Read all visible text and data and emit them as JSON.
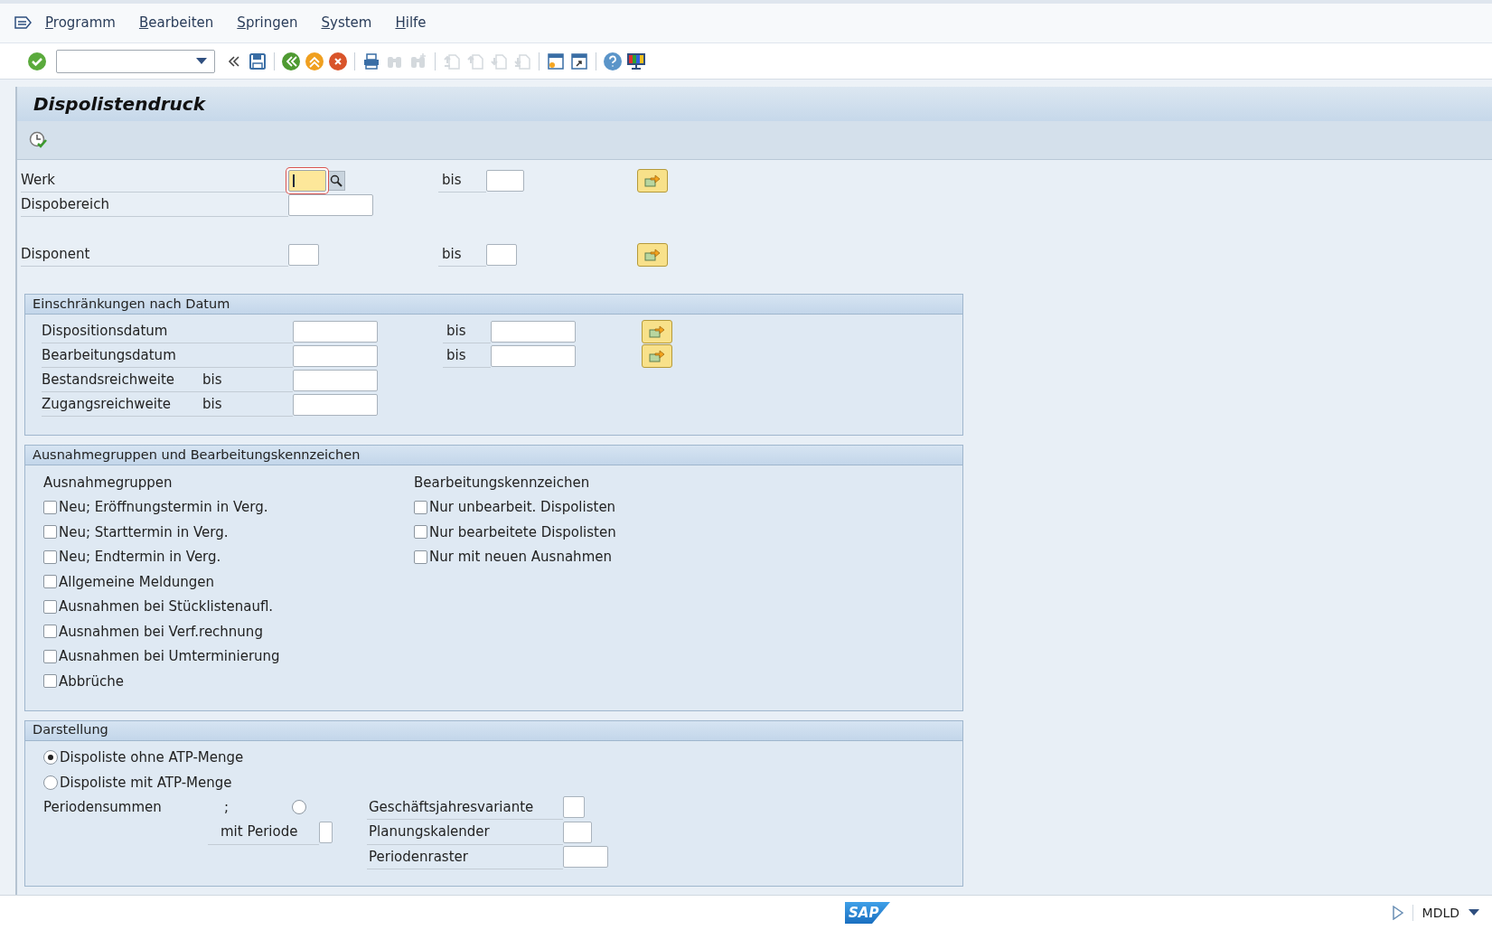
{
  "menu_bar": {
    "items": [
      "Programm",
      "Bearbeiten",
      "Springen",
      "System",
      "Hilfe"
    ]
  },
  "toolbar": [
    {
      "kind": "enter",
      "disabled": false
    },
    {
      "kind": "command"
    },
    {
      "kind": "collapse",
      "disabled": false
    },
    {
      "kind": "save",
      "disabled": false
    },
    {
      "kind": "sep"
    },
    {
      "kind": "back",
      "disabled": false
    },
    {
      "kind": "exit",
      "disabled": false
    },
    {
      "kind": "cancel",
      "disabled": false
    },
    {
      "kind": "sep"
    },
    {
      "kind": "print",
      "disabled": false
    },
    {
      "kind": "find",
      "disabled": true
    },
    {
      "kind": "find_next",
      "disabled": true
    },
    {
      "kind": "sep"
    },
    {
      "kind": "first_page",
      "disabled": true
    },
    {
      "kind": "prev_page",
      "disabled": true
    },
    {
      "kind": "next_page",
      "disabled": true
    },
    {
      "kind": "last_page",
      "disabled": true
    },
    {
      "kind": "sep"
    },
    {
      "kind": "new_session",
      "disabled": false
    },
    {
      "kind": "shortcut",
      "disabled": false
    },
    {
      "kind": "sep"
    },
    {
      "kind": "help",
      "disabled": false
    },
    {
      "kind": "layout",
      "disabled": false
    }
  ],
  "screen_title": "Dispolistendruck",
  "top_fields": [
    {
      "label": "Werk",
      "focused": true,
      "search_help": true,
      "to_label": "bis"
    },
    {
      "label": "Dispobereich",
      "focused": false,
      "search_help": false
    },
    {
      "label": "Disponent",
      "focused": false,
      "search_help": false,
      "to_label": "bis"
    }
  ],
  "date_restrictions": {
    "title": "Einschränkungen nach Datum",
    "rows": [
      {
        "label": "Dispositionsdatum",
        "to_label": "bis"
      },
      {
        "label": "Bearbeitungsdatum",
        "to_label": "bis"
      },
      {
        "label": "Bestandsreichweite",
        "suffix": "bis"
      },
      {
        "label": "Zugangsreichweite",
        "suffix": "bis"
      }
    ]
  },
  "exceptions": {
    "title": "Ausnahmegruppen und Bearbeitungskennzeichen",
    "groups_heading": "Ausnahmegruppen",
    "groups": [
      {
        "label": "Neu; Eröffnungstermin in Verg.",
        "checked": false
      },
      {
        "label": "Neu; Starttermin in Verg.",
        "checked": false
      },
      {
        "label": "Neu; Endtermin in Verg.",
        "checked": false
      },
      {
        "label": "Allgemeine Meldungen",
        "checked": false
      },
      {
        "label": "Ausnahmen bei Stücklistenaufl.",
        "checked": false
      },
      {
        "label": "Ausnahmen bei Verf.rechnung",
        "checked": false
      },
      {
        "label": "Ausnahmen bei Umterminierung",
        "checked": false
      },
      {
        "label": "Abbrüche",
        "checked": false
      }
    ],
    "processing_heading": "Bearbeitungskennzeichen",
    "processing": [
      {
        "label": "Nur unbearbeit. Dispolisten",
        "checked": false
      },
      {
        "label": "Nur bearbeitete Dispolisten",
        "checked": false
      },
      {
        "label": "Nur mit neuen Ausnahmen",
        "checked": false
      }
    ]
  },
  "display": {
    "title": "Darstellung",
    "options": [
      {
        "label": "Dispoliste ohne ATP-Menge",
        "selected": true
      },
      {
        "label": "Dispoliste mit ATP-Menge",
        "selected": false
      }
    ],
    "period_totals": {
      "label": "Periodensummen",
      "separator": ";",
      "selected": false,
      "period_label": "mit Periode"
    },
    "fields": [
      "Geschäftsjahresvariante",
      "Planungskalender",
      "Periodenraster"
    ]
  },
  "status_bar": {
    "logo": "SAP",
    "system": "MDLD"
  }
}
